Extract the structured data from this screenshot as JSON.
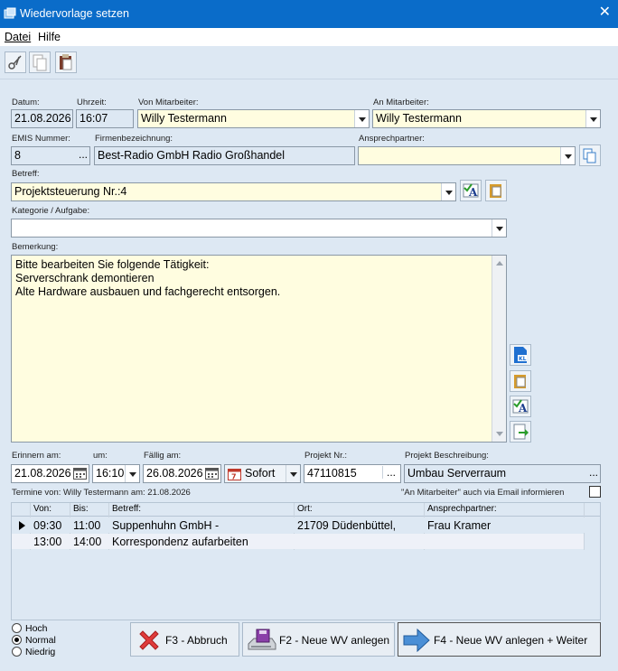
{
  "window": {
    "title": "Wiedervorlage setzen",
    "close_glyph": "✕"
  },
  "menu": {
    "datei": "Datei",
    "hilfe": "Hilfe"
  },
  "toolbar": {
    "icons": [
      "scissors-icon",
      "copy-icon",
      "paste-icon"
    ]
  },
  "labels": {
    "datum": "Datum:",
    "uhrzeit": "Uhrzeit:",
    "von_mitarbeiter": "Von Mitarbeiter:",
    "an_mitarbeiter": "An Mitarbeiter:",
    "emis_nummer": "EMIS Nummer:",
    "firmenbezeichnung": "Firmenbezeichnung:",
    "ansprechpartner": "Ansprechpartner:",
    "betreff": "Betreff:",
    "kategorie": "Kategorie / Aufgabe:",
    "bemerkung": "Bemerkung:",
    "erinnern_am": "Erinnern am:",
    "um": "um:",
    "faellig_am": "Fällig am:",
    "projekt_nr": "Projekt Nr.:",
    "projekt_beschreibung": "Projekt Beschreibung:",
    "termine_von": "Termine von: Willy Testermann am: 21.08.2026",
    "email_info": "\"An Mitarbeiter\" auch via Email informieren"
  },
  "fields": {
    "datum": "21.08.2026",
    "uhrzeit": "16:07",
    "von_mitarbeiter": "Willy Testermann",
    "an_mitarbeiter": "Willy Testermann",
    "emis_nummer": "8",
    "emis_dots": "...",
    "firmenbezeichnung": "Best-Radio GmbH Radio Großhandel",
    "ansprechpartner": "",
    "betreff": "Projektsteuerung Nr.:4",
    "kategorie": "",
    "bemerkung": [
      "Bitte bearbeiten Sie folgende Tätigkeit:",
      "Serverschrank demontieren",
      "Alte Hardware ausbauen und fachgerecht entsorgen."
    ],
    "erinnern_am": "21.08.2026",
    "um": "16:10",
    "faellig_am": "26.08.2026",
    "sofort": "Sofort",
    "projekt_nr": "47110815",
    "projekt_dots": "...",
    "projekt_beschreibung": "Umbau Serverraum",
    "beschreibung_dots": "..."
  },
  "grid": {
    "columns": [
      "Von:",
      "Bis:",
      "Betreff:",
      "Ort:",
      "Ansprechpartner:"
    ],
    "rows": [
      {
        "von": "09:30",
        "bis": "11:00",
        "betreff": "Suppenhuhn GmbH -",
        "ort": "21709 Düdenbüttel,",
        "ansprechpartner": "Frau Kramer"
      },
      {
        "von": "13:00",
        "bis": "14:00",
        "betreff": "Korrespondenz aufarbeiten",
        "ort": "",
        "ansprechpartner": ""
      }
    ]
  },
  "priority": {
    "options": [
      "Hoch",
      "Normal",
      "Niedrig"
    ],
    "selected": "Normal"
  },
  "buttons": {
    "abbruch": "F3 - Abbruch",
    "neue_wv": "F2 - Neue WV anlegen",
    "weiter": "F4 - Neue WV anlegen + Weiter"
  },
  "colors": {
    "titlebar": "#0a6cc9",
    "background": "#dde8f3",
    "input_yellow": "#fffde0"
  }
}
